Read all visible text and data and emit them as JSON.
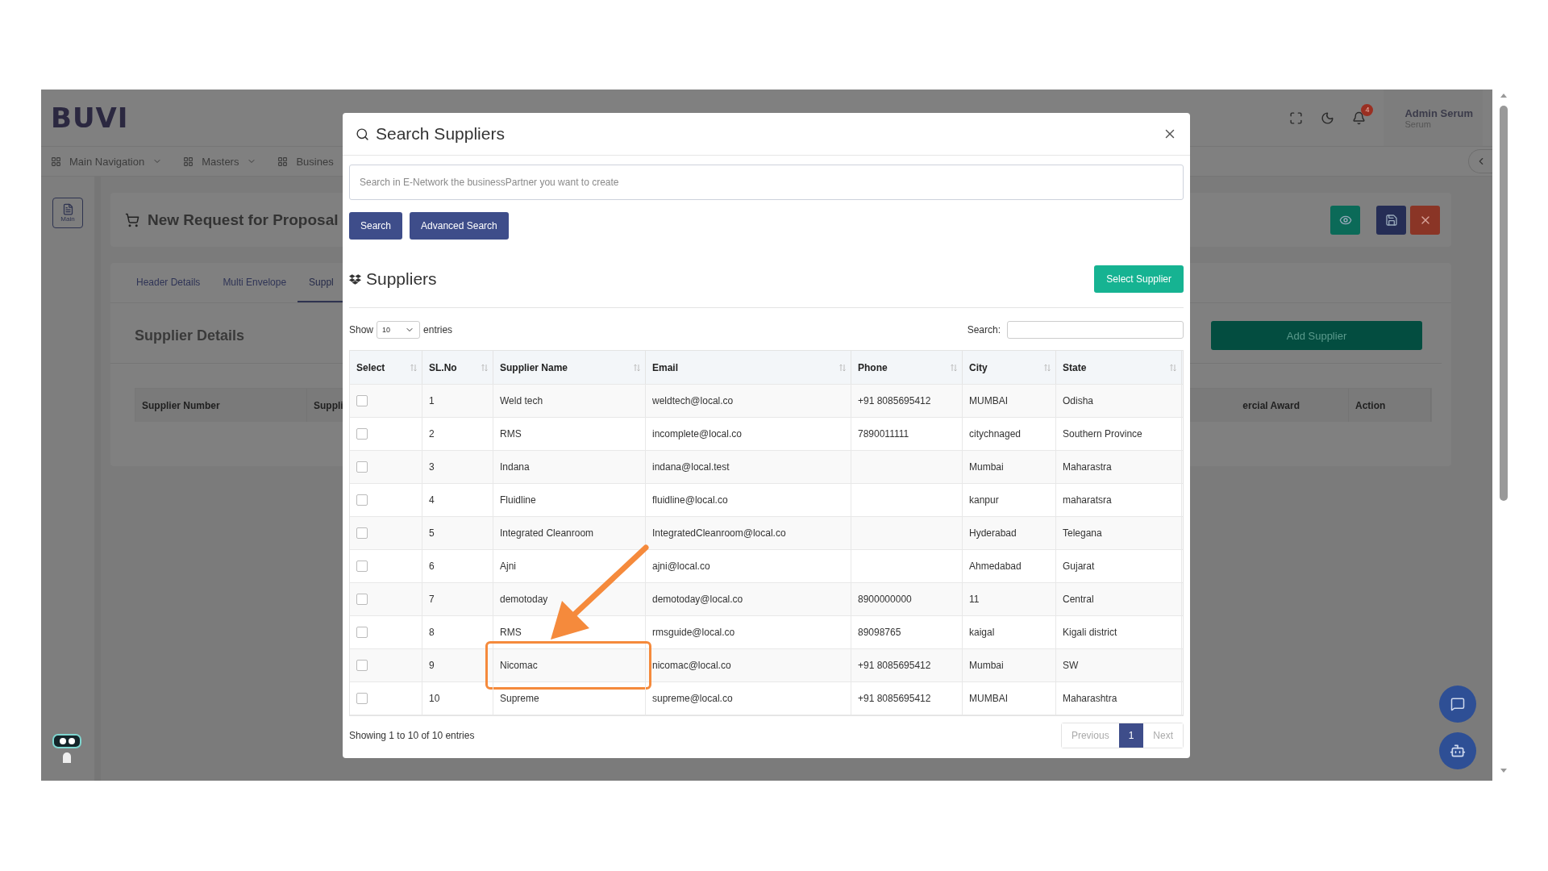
{
  "app": {
    "logo": "BUVI",
    "nav": [
      {
        "label": "Main Navigation",
        "dropdown": true
      },
      {
        "label": "Masters",
        "dropdown": true
      },
      {
        "label": "Busines",
        "dropdown": false
      }
    ],
    "notification_count": "4",
    "user": {
      "name": "Admin Serum",
      "role": "Serum"
    }
  },
  "sidebar": {
    "button": "Main"
  },
  "page": {
    "title": "New Request for Proposal",
    "tabs": [
      {
        "label": "Header Details",
        "selected": false
      },
      {
        "label": "Multi Envelope",
        "selected": false
      },
      {
        "label": "Suppl",
        "selected": true
      }
    ],
    "section_title": "Supplier Details",
    "add_button": "Add Supplier",
    "columns_left": [
      "Supplier Number",
      "Suppli"
    ],
    "columns_right": [
      "ercial Award",
      "Action"
    ]
  },
  "modal": {
    "title": "Search Suppliers",
    "search_placeholder": "Search in E-Network the businessPartner you want to create",
    "buttons": [
      "Search",
      "Advanced Search"
    ],
    "suppliers_title": "Suppliers",
    "select_button": "Select Supplier",
    "show_label": "Show",
    "page_size": "10",
    "entries_label": "entries",
    "search_label": "Search:",
    "columns": [
      "Select",
      "SL.No",
      "Supplier Name",
      "Email",
      "Phone",
      "City",
      "State"
    ],
    "rows": [
      {
        "checked": false,
        "highlighted": false,
        "sl": "1",
        "name": "Weld tech",
        "email": "weldtech@local.co",
        "phone": "+91 8085695412",
        "city": "MUMBAI",
        "state": "Odisha"
      },
      {
        "checked": false,
        "highlighted": false,
        "sl": "2",
        "name": "RMS",
        "email": "incomplete@local.co",
        "phone": "7890011111",
        "city": "citychnaged",
        "state": "Southern Province"
      },
      {
        "checked": false,
        "highlighted": false,
        "sl": "3",
        "name": "Indana",
        "email": "indana@local.test",
        "phone": "",
        "city": "Mumbai",
        "state": "Maharastra"
      },
      {
        "checked": false,
        "highlighted": false,
        "sl": "4",
        "name": "Fluidline",
        "email": "fluidline@local.co",
        "phone": "",
        "city": "kanpur",
        "state": "maharatsra"
      },
      {
        "checked": false,
        "highlighted": false,
        "sl": "5",
        "name": "Integrated Cleanroom",
        "email": "IntegratedCleanroom@local.co",
        "phone": "",
        "city": "Hyderabad",
        "state": "Telegana"
      },
      {
        "checked": false,
        "highlighted": false,
        "sl": "6",
        "name": "Ajni",
        "email": "ajni@local.co",
        "phone": "",
        "city": "Ahmedabad",
        "state": "Gujarat"
      },
      {
        "checked": false,
        "highlighted": false,
        "sl": "7",
        "name": "demotoday",
        "email": "demotoday@local.co",
        "phone": "8900000000",
        "city": "11",
        "state": "Central"
      },
      {
        "checked": false,
        "highlighted": false,
        "sl": "8",
        "name": "RMS",
        "email": "rmsguide@local.co",
        "phone": "89098765",
        "city": "kaigal",
        "state": "Kigali district"
      },
      {
        "checked": false,
        "highlighted": true,
        "sl": "9",
        "name": "Nicomac",
        "email": "nicomac@local.co",
        "phone": "+91 8085695412",
        "city": "Mumbai",
        "state": "SW"
      },
      {
        "checked": false,
        "highlighted": false,
        "sl": "10",
        "name": "Supreme",
        "email": "supreme@local.co",
        "phone": "+91 8085695412",
        "city": "MUMBAI",
        "state": "Maharashtra"
      }
    ],
    "info": "Showing 1 to 10 of 10 entries",
    "pagination": [
      {
        "label": "Previous",
        "selected": false,
        "disabled": true
      },
      {
        "label": "1",
        "selected": true,
        "disabled": false
      },
      {
        "label": "Next",
        "selected": false,
        "disabled": true
      }
    ]
  }
}
